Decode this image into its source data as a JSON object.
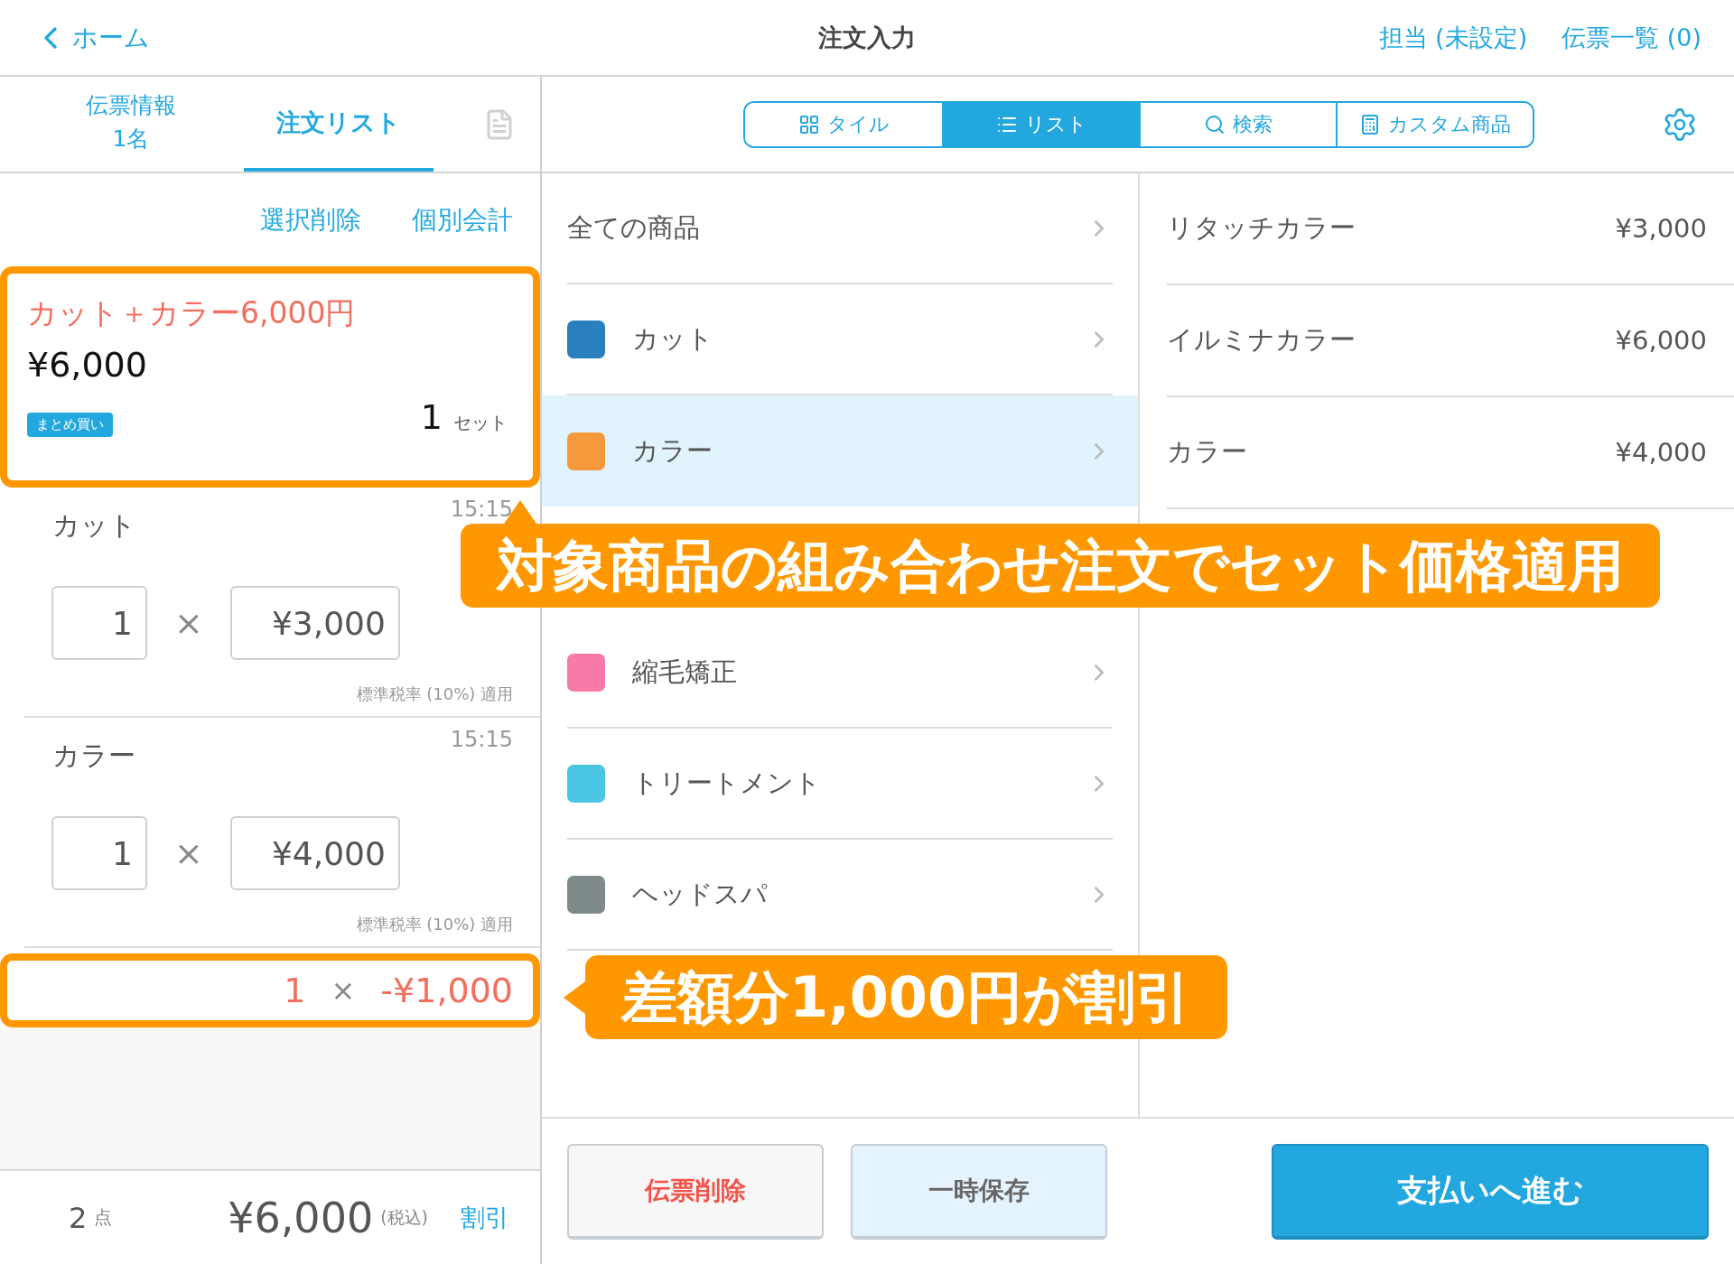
{
  "header": {
    "back": "ホーム",
    "title": "注文入力",
    "links": [
      "担当 (未設定)",
      "伝票一覧 (0)"
    ]
  },
  "left_tabs": [
    {
      "label": "伝票情報",
      "sub": "1名",
      "selected": false
    },
    {
      "label": "注文リスト",
      "selected": true
    }
  ],
  "actions": [
    "選択削除",
    "個別会計"
  ],
  "set_item": {
    "name": "カット＋カラー6,000円",
    "price": "¥6,000",
    "badge": "まとめ買い",
    "qty": "1",
    "unit": "セット",
    "highlighted": true,
    "callout": "対象商品の組み合わせ注文でセット価格適用"
  },
  "order_items": [
    {
      "name": "カット",
      "time": "15:15",
      "qty": "1",
      "times": "×",
      "price": "¥3,000",
      "tax_note": "標準税率 (10%) 適用"
    },
    {
      "name": "カラー",
      "time": "15:15",
      "qty": "1",
      "times": "×",
      "price": "¥4,000",
      "tax_note": "標準税率 (10%) 適用"
    }
  ],
  "discount": {
    "qty": "1",
    "times": "×",
    "amount": "-¥1,000",
    "highlighted": true,
    "callout": "差額分1,000円が割引"
  },
  "footer": {
    "count": "2",
    "count_unit": "点",
    "total": "¥6,000",
    "tax": "(税込)",
    "discount_link": "割引"
  },
  "view_modes": [
    {
      "kind": "tile",
      "label": "タイル",
      "selected": false
    },
    {
      "kind": "list",
      "label": "リスト",
      "selected": true
    },
    {
      "kind": "search",
      "label": "検索",
      "selected": false
    },
    {
      "kind": "custom",
      "label": "カスタム商品",
      "selected": false
    }
  ],
  "categories": [
    {
      "kind": "all",
      "name": "全ての商品",
      "selected": false
    },
    {
      "kind": "category",
      "name": "カット",
      "color": "#2a7fbf",
      "selected": false
    },
    {
      "kind": "category",
      "name": "カラー",
      "color": "#f5993c",
      "selected": true
    },
    {
      "kind": "category",
      "name": "縮毛矯正",
      "color": "#f77aa8",
      "selected": false
    },
    {
      "kind": "category",
      "name": "トリートメント",
      "color": "#4ac6e2",
      "selected": false
    },
    {
      "kind": "category",
      "name": "ヘッドスパ",
      "color": "#7f8b8b",
      "selected": false
    }
  ],
  "products": [
    {
      "name": "リタッチカラー",
      "price": "¥3,000"
    },
    {
      "name": "イルミナカラー",
      "price": "¥6,000"
    },
    {
      "name": "カラー",
      "price": "¥4,000"
    }
  ],
  "buttons": [
    {
      "kind": "delete",
      "label": "伝票削除"
    },
    {
      "kind": "save",
      "label": "一時保存"
    },
    {
      "kind": "pay",
      "label": "支払いへ進む"
    }
  ]
}
